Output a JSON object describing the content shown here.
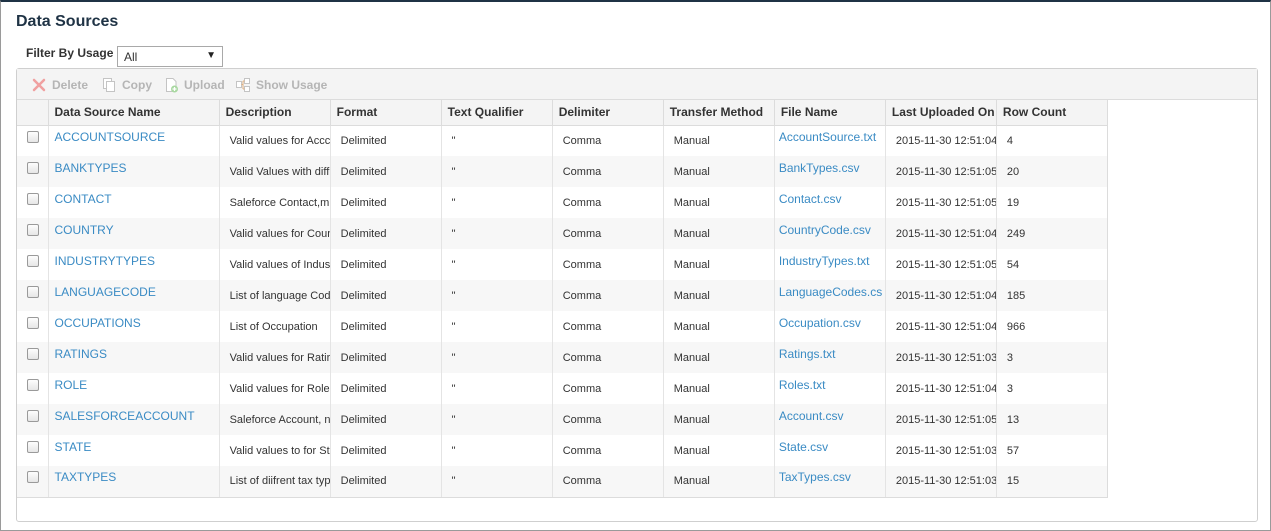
{
  "page": {
    "title": "Data Sources",
    "filter_label": "Filter By Usage",
    "filter_value": "All"
  },
  "toolbar": {
    "delete_label": "Delete",
    "copy_label": "Copy",
    "upload_label": "Upload",
    "show_usage_label": "Show Usage",
    "icons": [
      "delete-icon",
      "copy-icon",
      "upload-icon",
      "show-usage-icon"
    ],
    "disabled_color": "#b5b5b5"
  },
  "colors": {
    "title": "#1f3345",
    "link": "#3a8bc4",
    "row_alt": "#f7f7f7"
  },
  "table": {
    "columns": [
      "Data Source Name",
      "Description",
      "Format",
      "Text Qualifier",
      "Delimiter",
      "Transfer Method",
      "File Name",
      "Last Uploaded On",
      "Row Count"
    ],
    "rows": [
      {
        "name": "ACCOUNTSOURCE",
        "description": "Valid values for Accc",
        "format": "Delimited",
        "qualifier": "\"",
        "delimiter": "Comma",
        "transfer": "Manual",
        "file": "AccountSource.txt",
        "uploaded": "2015-11-30 12:51:04",
        "count": "4"
      },
      {
        "name": "BANKTYPES",
        "description": "Valid Values with diffi",
        "format": "Delimited",
        "qualifier": "\"",
        "delimiter": "Comma",
        "transfer": "Manual",
        "file": "BankTypes.csv",
        "uploaded": "2015-11-30 12:51:05",
        "count": "20"
      },
      {
        "name": "CONTACT",
        "description": "Saleforce Contact,m",
        "format": "Delimited",
        "qualifier": "\"",
        "delimiter": "Comma",
        "transfer": "Manual",
        "file": "Contact.csv",
        "uploaded": "2015-11-30 12:51:05",
        "count": "19"
      },
      {
        "name": "COUNTRY",
        "description": "Valid values for Coun",
        "format": "Delimited",
        "qualifier": "\"",
        "delimiter": "Comma",
        "transfer": "Manual",
        "file": "CountryCode.csv",
        "uploaded": "2015-11-30 12:51:04",
        "count": "249"
      },
      {
        "name": "INDUSTRYTYPES",
        "description": "Valid values of Indus",
        "format": "Delimited",
        "qualifier": "\"",
        "delimiter": "Comma",
        "transfer": "Manual",
        "file": "IndustryTypes.txt",
        "uploaded": "2015-11-30 12:51:05",
        "count": "54"
      },
      {
        "name": "LANGUAGECODE",
        "description": "List of language Code",
        "format": "Delimited",
        "qualifier": "\"",
        "delimiter": "Comma",
        "transfer": "Manual",
        "file": "LanguageCodes.cs",
        "uploaded": "2015-11-30 12:51:04",
        "count": "185"
      },
      {
        "name": "OCCUPATIONS",
        "description": "List of Occupation",
        "format": "Delimited",
        "qualifier": "\"",
        "delimiter": "Comma",
        "transfer": "Manual",
        "file": "Occupation.csv",
        "uploaded": "2015-11-30 12:51:04",
        "count": "966"
      },
      {
        "name": "RATINGS",
        "description": "Valid values for Ratir",
        "format": "Delimited",
        "qualifier": "\"",
        "delimiter": "Comma",
        "transfer": "Manual",
        "file": "Ratings.txt",
        "uploaded": "2015-11-30 12:51:03",
        "count": "3"
      },
      {
        "name": "ROLE",
        "description": "Valid values for Role",
        "format": "Delimited",
        "qualifier": "\"",
        "delimiter": "Comma",
        "transfer": "Manual",
        "file": "Roles.txt",
        "uploaded": "2015-11-30 12:51:04",
        "count": "3"
      },
      {
        "name": "SALESFORCEACCOUNT",
        "description": "Saleforce Account, n",
        "format": "Delimited",
        "qualifier": "\"",
        "delimiter": "Comma",
        "transfer": "Manual",
        "file": "Account.csv",
        "uploaded": "2015-11-30 12:51:05",
        "count": "13"
      },
      {
        "name": "STATE",
        "description": "Valid values to for St",
        "format": "Delimited",
        "qualifier": "\"",
        "delimiter": "Comma",
        "transfer": "Manual",
        "file": "State.csv",
        "uploaded": "2015-11-30 12:51:03",
        "count": "57"
      },
      {
        "name": "TAXTYPES",
        "description": "List of diifrent tax typ",
        "format": "Delimited",
        "qualifier": "\"",
        "delimiter": "Comma",
        "transfer": "Manual",
        "file": "TaxTypes.csv",
        "uploaded": "2015-11-30 12:51:03",
        "count": "15"
      }
    ]
  }
}
